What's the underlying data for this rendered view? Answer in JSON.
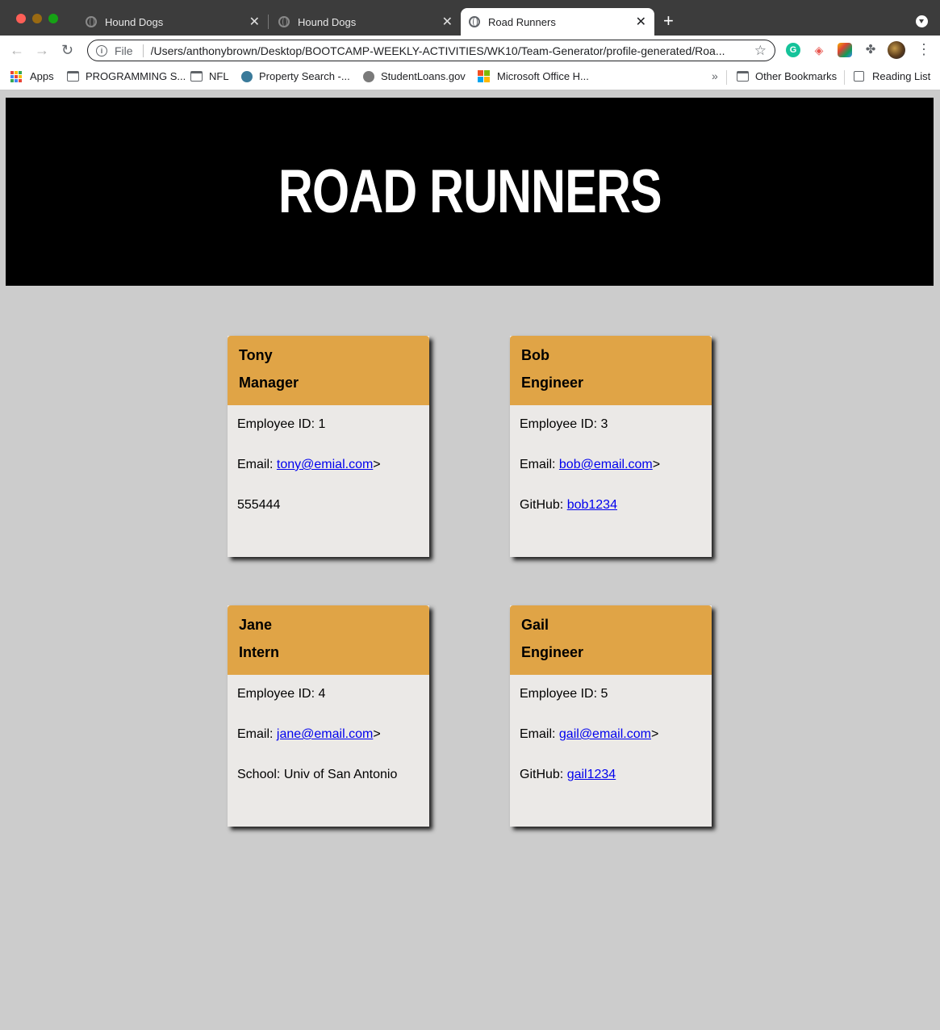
{
  "browser": {
    "tabs": [
      {
        "title": "Hound Dogs",
        "active": false
      },
      {
        "title": "Hound Dogs",
        "active": false
      },
      {
        "title": "Road Runners",
        "active": true
      }
    ],
    "address": {
      "scheme": "File",
      "url": "/Users/anthonybrown/Desktop/BOOTCAMP-WEEKLY-ACTIVITIES/WK10/Team-Generator/profile-generated/Roa..."
    },
    "bookmarks": [
      {
        "label": "Apps",
        "icon": "apps-grid-icon"
      },
      {
        "label": "PROGRAMMING S...",
        "icon": "folder-icon"
      },
      {
        "label": "NFL",
        "icon": "folder-icon"
      },
      {
        "label": "Property Search -...",
        "icon": "gear-icon"
      },
      {
        "label": "StudentLoans.gov",
        "icon": "seal-icon"
      },
      {
        "label": "Microsoft Office H...",
        "icon": "microsoft-icon"
      }
    ],
    "bookmarks_right": [
      {
        "label": "Other Bookmarks",
        "icon": "folder-icon"
      },
      {
        "label": "Reading List",
        "icon": "reading-list-icon"
      }
    ],
    "colors": {
      "tab_bar": "#3c3c3c",
      "toolbar": "#ffffff"
    }
  },
  "page": {
    "team_title": "ROAD RUNNERS",
    "colors": {
      "header_bg": "#000000",
      "card_head": "#e0a446",
      "card_body": "#ebe9e7",
      "page_bg": "#cccccc"
    },
    "employees": [
      {
        "name": "Tony",
        "role": "Manager",
        "id_line": "Employee ID: 1",
        "email_prefix": "Email: ",
        "email": "tony@emial.com",
        "email_suffix": ">",
        "extra_prefix": "",
        "extra": "555444"
      },
      {
        "name": "Bob",
        "role": "Engineer",
        "id_line": "Employee ID: 3",
        "email_prefix": "Email: ",
        "email": "bob@email.com",
        "email_suffix": ">",
        "extra_prefix": "GitHub: ",
        "extra": "bob1234"
      },
      {
        "name": "Jane",
        "role": "Intern",
        "id_line": "Employee ID: 4",
        "email_prefix": "Email: ",
        "email": "jane@email.com",
        "email_suffix": ">",
        "extra_prefix": "School: ",
        "extra": "Univ of San Antonio"
      },
      {
        "name": "Gail",
        "role": "Engineer",
        "id_line": "Employee ID: 5",
        "email_prefix": "Email: ",
        "email": "gail@email.com",
        "email_suffix": ">",
        "extra_prefix": "GitHub: ",
        "extra": "gail1234"
      }
    ]
  }
}
